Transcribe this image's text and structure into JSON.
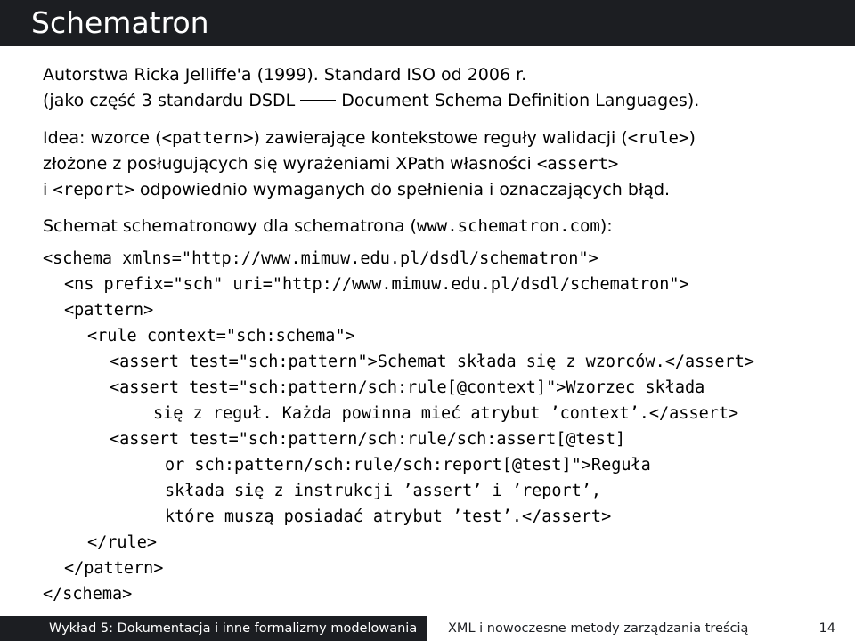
{
  "slide": {
    "title": "Schematron",
    "intro_line1": "Autorstwa Ricka Jelliffe'a (1999). Standard ISO od 2006 r.",
    "intro_line2_a": "(jako część 3 standardu DSDL",
    "intro_line2_b": "Document Schema Definition Languages).",
    "idea": {
      "p1": "Idea: wzorce (",
      "c1": "<pattern>",
      "p2": ") zawierające kontekstowe reguły walidacji (",
      "c2": "<rule>",
      "p3": ")",
      "p4": "złożone z posługujących się wyrażeniami XPath własności ",
      "c3": "<assert>",
      "p5": "i ",
      "c4": "<report>",
      "p6": " odpowiednio wymaganych do spełnienia i oznaczających błąd."
    },
    "schema_intro": {
      "text": "Schemat schematronowy dla schematrona (",
      "url": "www.schematron.com",
      "end": "):"
    },
    "code_lines": [
      "<schema xmlns=\"http://www.mimuw.edu.pl/dsdl/schematron\">",
      "<ns prefix=\"sch\" uri=\"http://www.mimuw.edu.pl/dsdl/schematron\">",
      "<pattern>",
      "<rule context=\"sch:schema\">",
      "<assert test=\"sch:pattern\">Schemat składa się z wzorców.</assert>",
      "<assert test=\"sch:pattern/sch:rule[@context]\">Wzorzec składa",
      "się z reguł. Każda powinna mieć atrybut ’context’.</assert>",
      "<assert test=\"sch:pattern/sch:rule/sch:assert[@test]",
      "or sch:pattern/sch:rule/sch:report[@test]\">Reguła",
      "składa się z instrukcji ’assert’ i ’report’,",
      "które muszą posiadać atrybut ’test’.</assert>",
      "</rule>",
      "</pattern>",
      "</schema>"
    ],
    "footer": {
      "lecture": "Wykład 5: Dokumentacja i inne formalizmy modelowania",
      "course": "XML i nowoczesne metody zarządzania treścią",
      "page": "14"
    },
    "colors": {
      "bar": "#1c1e22",
      "background": "#ffffff"
    }
  }
}
